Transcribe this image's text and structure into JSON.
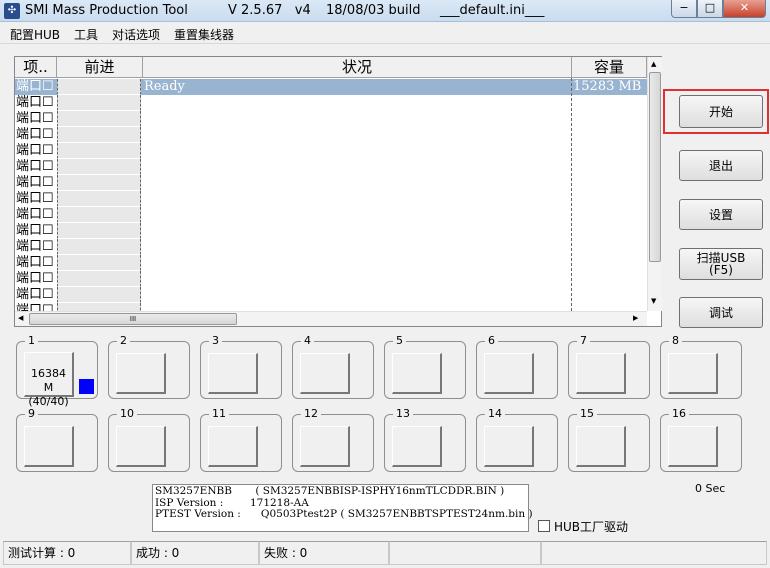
{
  "title": {
    "app": "SMI Mass Production Tool",
    "version": "V 2.5.67   v4",
    "build": "18/08/03 build",
    "ini": "___default.ini___"
  },
  "window_controls": {
    "minimize": "−",
    "maximize": "□",
    "close": "✕"
  },
  "menu": [
    "配置HUB",
    "工具",
    "对话选项",
    "重置集线器"
  ],
  "list": {
    "headers": [
      "项..",
      "前进",
      "状况",
      "容量"
    ],
    "rows": [
      {
        "port": "端口",
        "check": "☐",
        "status": "Ready",
        "capacity": "15283 MB",
        "selected": true
      },
      {
        "port": "端口",
        "check": "☐"
      },
      {
        "port": "端口",
        "check": "☐"
      },
      {
        "port": "端口",
        "check": "☐"
      },
      {
        "port": "端口",
        "check": "☐"
      },
      {
        "port": "端口",
        "check": "☐"
      },
      {
        "port": "端口",
        "check": "☐"
      },
      {
        "port": "端口",
        "check": "☐"
      },
      {
        "port": "端口",
        "check": "☐"
      },
      {
        "port": "端口",
        "check": "☐"
      },
      {
        "port": "端口",
        "check": "☐"
      },
      {
        "port": "端口",
        "check": "☐"
      },
      {
        "port": "端口",
        "check": "☐"
      },
      {
        "port": "端口",
        "check": "☐"
      },
      {
        "port": "端口",
        "check": "☐"
      }
    ],
    "hscroll_grip": "III"
  },
  "buttons": {
    "start": "开始",
    "exit": "退出",
    "settings": "设置",
    "scan_line1": "扫描USB",
    "scan_line2": "(F5)",
    "debug": "调试"
  },
  "ports": [
    {
      "label": "1",
      "capacity": "16384 M",
      "progress": "(40/40)",
      "indicator": "#0000ff"
    },
    {
      "label": "2"
    },
    {
      "label": "3"
    },
    {
      "label": "4"
    },
    {
      "label": "5"
    },
    {
      "label": "6"
    },
    {
      "label": "7"
    },
    {
      "label": "8"
    },
    {
      "label": "9"
    },
    {
      "label": "10"
    },
    {
      "label": "11"
    },
    {
      "label": "12"
    },
    {
      "label": "13"
    },
    {
      "label": "14"
    },
    {
      "label": "15"
    },
    {
      "label": "16"
    }
  ],
  "timer": "0 Sec",
  "info": {
    "line1": "SM3257ENBB       ( SM3257ENBBISP-ISPHY16nmTLCDDR.BIN )",
    "line2": "ISP Version :        171218-AA",
    "line3": "PTEST Version :      Q0503Ptest2P ( SM3257ENBBTSPTEST24nm.bin )"
  },
  "hub_driver": "HUB工厂驱动",
  "status": {
    "tested": "测试计算 : 0",
    "success": "成功 : 0",
    "fail": "失败 : 0"
  },
  "colors": {
    "highlight": "#99b4d1",
    "start_outline": "#e03030"
  }
}
